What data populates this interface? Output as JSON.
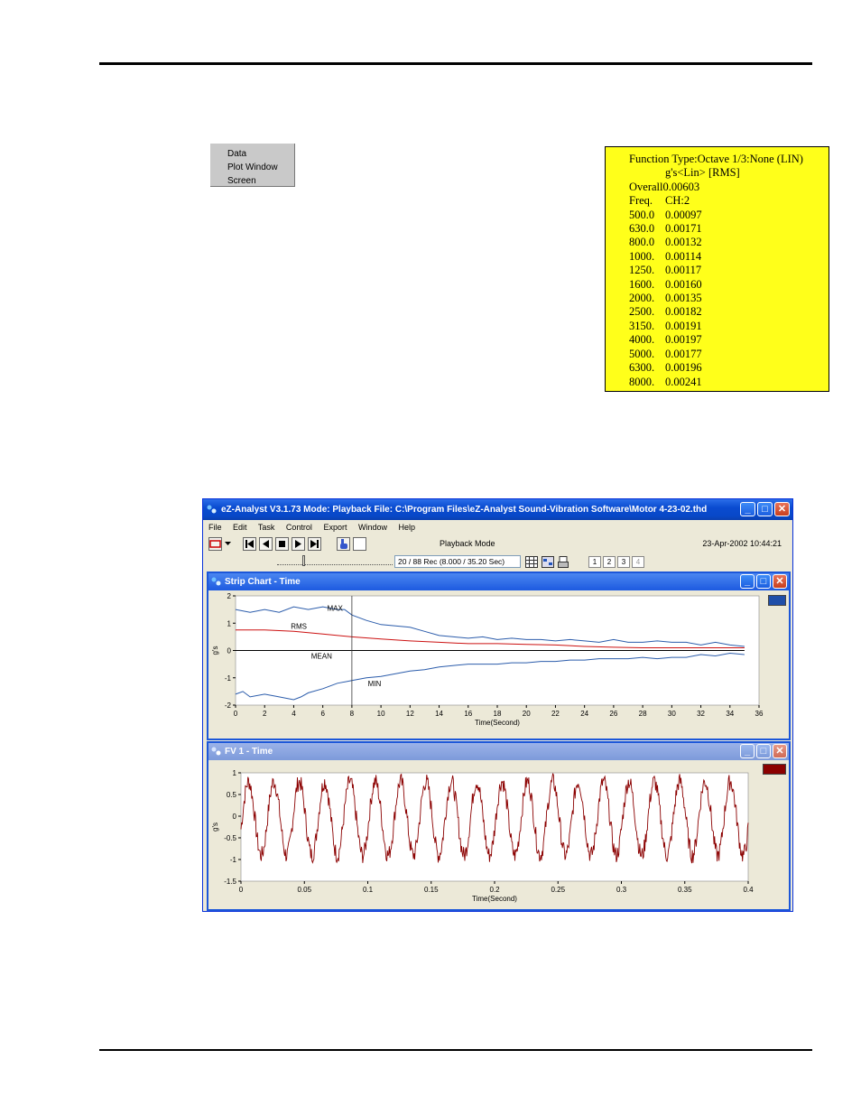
{
  "context_menu": {
    "items": [
      "Data",
      "Plot Window",
      "Screen"
    ]
  },
  "readout": {
    "title": "Function Type:Octave 1/3:None (LIN)",
    "units": "g's<Lin> [RMS]",
    "overall_label": "Overall",
    "overall_value": "0.00603",
    "col_freq": "Freq.",
    "col_ch": "CH:2",
    "rows": [
      [
        "500.0",
        "0.00097"
      ],
      [
        "630.0",
        "0.00171"
      ],
      [
        "800.0",
        "0.00132"
      ],
      [
        "1000.",
        "0.00114"
      ],
      [
        "1250.",
        "0.00117"
      ],
      [
        "1600.",
        "0.00160"
      ],
      [
        "2000.",
        "0.00135"
      ],
      [
        "2500.",
        "0.00182"
      ],
      [
        "3150.",
        "0.00191"
      ],
      [
        "4000.",
        "0.00197"
      ],
      [
        "5000.",
        "0.00177"
      ],
      [
        "6300.",
        "0.00196"
      ],
      [
        "8000.",
        "0.00241"
      ]
    ]
  },
  "window": {
    "title": "eZ-Analyst  V3.1.73  Mode: Playback  File: C:\\Program Files\\eZ-Analyst Sound-Vibration Software\\Motor 4-23-02.thd",
    "menu": [
      "File",
      "Edit",
      "Task",
      "Control",
      "Export",
      "Window",
      "Help"
    ],
    "playback_mode": "Playback Mode",
    "datetime": "23-Apr-2002 10:44:21",
    "record_text": "20 / 88 Rec (8.000 / 35.20 Sec)",
    "pages": [
      "1",
      "2",
      "3",
      "4"
    ]
  },
  "strip_chart": {
    "title": "Strip Chart  - Time",
    "chip_color": "#1f4ea8"
  },
  "fv_chart": {
    "title": "FV 1  - Time",
    "chip_color": "#8b0000"
  },
  "chart_data": [
    {
      "type": "line",
      "xlabel": "Time(Second)",
      "ylabel": "g's",
      "xlim": [
        0,
        36
      ],
      "ylim": [
        -2,
        2
      ],
      "xticks": [
        "0",
        "2",
        "4",
        "6",
        "8",
        "10",
        "12",
        "14",
        "16",
        "18",
        "20",
        "22",
        "24",
        "26",
        "28",
        "30",
        "32",
        "34",
        "36"
      ],
      "yticks": [
        "2",
        "1",
        "0",
        "-1",
        "-2"
      ],
      "cursor_x": 8,
      "annotations": [
        "MAX",
        "RMS",
        "MEAN",
        "MIN"
      ],
      "series": [
        {
          "name": "MAX",
          "color": "#2b5cab",
          "x": [
            0,
            1,
            2,
            3,
            4,
            5,
            6,
            7,
            7.5,
            8,
            9,
            10,
            11,
            12,
            13,
            14,
            15,
            16,
            17,
            18,
            19,
            20,
            21,
            22,
            23,
            24,
            25,
            26,
            27,
            28,
            29,
            30,
            31,
            32,
            33,
            34,
            35
          ],
          "values": [
            1.5,
            1.4,
            1.5,
            1.4,
            1.6,
            1.5,
            1.6,
            1.5,
            1.5,
            1.3,
            1.1,
            0.95,
            0.9,
            0.85,
            0.7,
            0.55,
            0.5,
            0.45,
            0.5,
            0.4,
            0.45,
            0.4,
            0.4,
            0.35,
            0.4,
            0.35,
            0.3,
            0.4,
            0.3,
            0.3,
            0.35,
            0.3,
            0.3,
            0.2,
            0.3,
            0.2,
            0.15
          ]
        },
        {
          "name": "RMS",
          "color": "#cc1111",
          "x": [
            0,
            2,
            4,
            6,
            8,
            10,
            12,
            14,
            16,
            18,
            20,
            22,
            24,
            26,
            28,
            30,
            32,
            34,
            35
          ],
          "values": [
            0.75,
            0.75,
            0.7,
            0.6,
            0.5,
            0.42,
            0.35,
            0.3,
            0.25,
            0.25,
            0.22,
            0.2,
            0.15,
            0.12,
            0.1,
            0.1,
            0.1,
            0.1,
            0.1
          ]
        },
        {
          "name": "MEAN",
          "color": "#000000",
          "x": [
            0,
            35
          ],
          "values": [
            0,
            0
          ]
        },
        {
          "name": "MIN",
          "color": "#2b5cab",
          "x": [
            0,
            0.5,
            1,
            2,
            3,
            4,
            4.5,
            5,
            6,
            7,
            8,
            9,
            10,
            11,
            12,
            13,
            14,
            15,
            16,
            17,
            18,
            19,
            20,
            21,
            22,
            23,
            24,
            25,
            26,
            27,
            28,
            29,
            30,
            31,
            32,
            33,
            34,
            35
          ],
          "values": [
            -1.6,
            -1.5,
            -1.7,
            -1.6,
            -1.7,
            -1.8,
            -1.7,
            -1.55,
            -1.4,
            -1.2,
            -1.1,
            -1.0,
            -0.95,
            -0.85,
            -0.75,
            -0.7,
            -0.6,
            -0.55,
            -0.5,
            -0.5,
            -0.5,
            -0.45,
            -0.45,
            -0.4,
            -0.4,
            -0.35,
            -0.35,
            -0.3,
            -0.3,
            -0.3,
            -0.25,
            -0.3,
            -0.25,
            -0.25,
            -0.15,
            -0.2,
            -0.1,
            -0.15
          ]
        }
      ]
    },
    {
      "type": "line",
      "xlabel": "Time(Second)",
      "ylabel": "g's",
      "xlim": [
        0,
        0.4
      ],
      "ylim": [
        -1.5,
        1
      ],
      "xticks": [
        "0",
        "0.05",
        "0.1",
        "0.15",
        "0.2",
        "0.25",
        "0.3",
        "0.35",
        "0.4"
      ],
      "yticks": [
        "1",
        "0.5",
        "0",
        "-0.5",
        "-1",
        "-1.5"
      ],
      "series": [
        {
          "name": "CH:2",
          "color": "#8b0000",
          "waveform": {
            "cycles": 20,
            "amplitude": 0.85,
            "offset": -0.05,
            "noise": 0.2,
            "samples": 800
          }
        }
      ]
    }
  ]
}
